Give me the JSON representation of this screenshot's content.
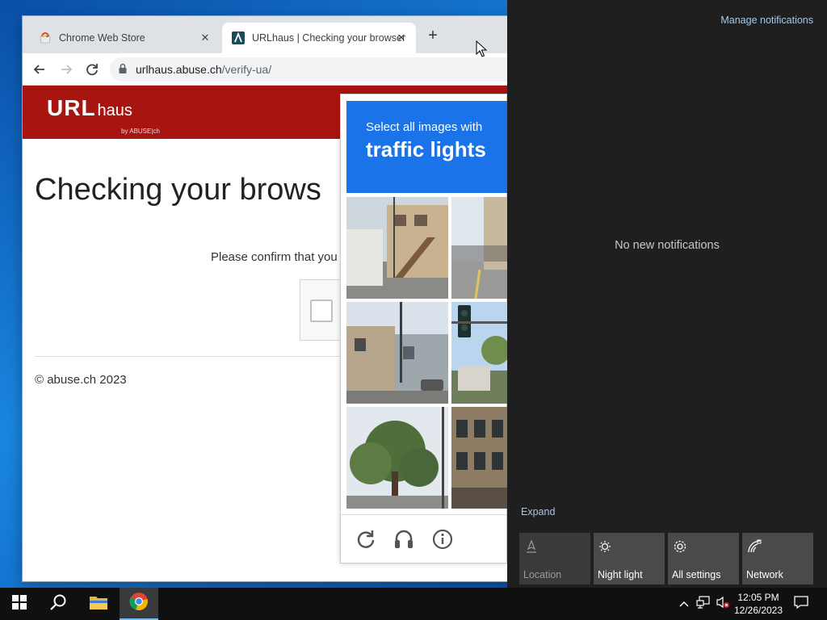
{
  "browser": {
    "tabs": [
      {
        "label": "Chrome Web Store",
        "icon": "chrome-web-store-icon"
      },
      {
        "label": "URLhaus | Checking your browser",
        "icon": "urlhaus-favicon"
      }
    ],
    "url_host": "urlhaus.abuse.ch",
    "url_path": "/verify-ua/"
  },
  "site": {
    "logo_main": "URL",
    "logo_sub": "haus",
    "logo_by": "by ABUSE|ch",
    "title": "Checking your brows",
    "confirm_text": "Please confirm that you",
    "copyright": "© abuse.ch 2023"
  },
  "captcha": {
    "prompt_line1": "Select all images with",
    "prompt_line2": "traffic lights",
    "footer_icons": [
      "reload-icon",
      "audio-challenge-icon",
      "info-icon"
    ]
  },
  "action_center": {
    "manage_label": "Manage notifications",
    "empty_label": "No new notifications",
    "expand_label": "Expand",
    "quick_actions": [
      {
        "label": "Location",
        "icon": "location-icon",
        "enabled": false
      },
      {
        "label": "Night light",
        "icon": "night-light-icon",
        "enabled": true
      },
      {
        "label": "All settings",
        "icon": "gear-icon",
        "enabled": true
      },
      {
        "label": "Network",
        "icon": "network-icon",
        "enabled": true
      }
    ]
  },
  "taskbar": {
    "time": "12:05 PM",
    "date": "12/26/2023"
  }
}
